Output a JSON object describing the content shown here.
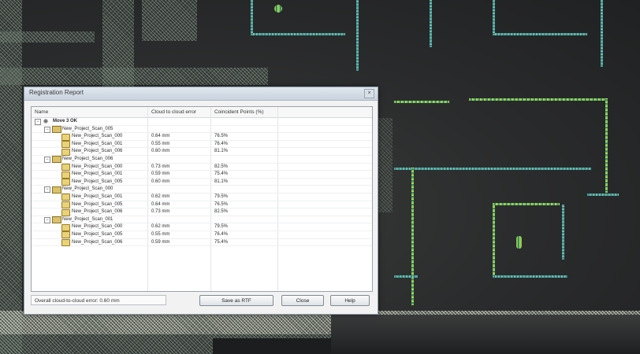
{
  "dialog": {
    "title": "Registration Report",
    "close_glyph": "×",
    "columns": [
      "Name",
      "Cloud to cloud error",
      "Coincident Points (%)"
    ],
    "tree": [
      {
        "level": 0,
        "kind": "root",
        "expander": "−",
        "name": "Move 3 OK",
        "error": "",
        "percent": ""
      },
      {
        "level": 1,
        "kind": "group",
        "expander": "−",
        "name": "New_Project_Scan_005",
        "error": "",
        "percent": ""
      },
      {
        "level": 2,
        "kind": "scan",
        "expander": "",
        "name": "New_Project_Scan_000",
        "error": "0.64 mm",
        "percent": "76.5%"
      },
      {
        "level": 2,
        "kind": "scan",
        "expander": "",
        "name": "New_Project_Scan_001",
        "error": "0.55 mm",
        "percent": "76.4%"
      },
      {
        "level": 2,
        "kind": "scan",
        "expander": "",
        "name": "New_Project_Scan_006",
        "error": "0.60 mm",
        "percent": "81.1%"
      },
      {
        "level": 1,
        "kind": "group",
        "expander": "−",
        "name": "New_Project_Scan_006",
        "error": "",
        "percent": ""
      },
      {
        "level": 2,
        "kind": "scan",
        "expander": "",
        "name": "New_Project_Scan_000",
        "error": "0.73 mm",
        "percent": "82.5%"
      },
      {
        "level": 2,
        "kind": "scan",
        "expander": "",
        "name": "New_Project_Scan_001",
        "error": "0.59 mm",
        "percent": "75.4%"
      },
      {
        "level": 2,
        "kind": "scan",
        "expander": "",
        "name": "New_Project_Scan_005",
        "error": "0.60 mm",
        "percent": "81.1%"
      },
      {
        "level": 1,
        "kind": "group",
        "expander": "−",
        "name": "New_Project_Scan_000",
        "error": "",
        "percent": ""
      },
      {
        "level": 2,
        "kind": "scan",
        "expander": "",
        "name": "New_Project_Scan_001",
        "error": "0.62 mm",
        "percent": "79.5%"
      },
      {
        "level": 2,
        "kind": "scan",
        "expander": "",
        "name": "New_Project_Scan_005",
        "error": "0.64 mm",
        "percent": "76.5%"
      },
      {
        "level": 2,
        "kind": "scan",
        "expander": "",
        "name": "New_Project_Scan_006",
        "error": "0.73 mm",
        "percent": "82.5%"
      },
      {
        "level": 1,
        "kind": "group",
        "expander": "−",
        "name": "New_Project_Scan_001",
        "error": "",
        "percent": ""
      },
      {
        "level": 2,
        "kind": "scan",
        "expander": "",
        "name": "New_Project_Scan_000",
        "error": "0.62 mm",
        "percent": "79.5%"
      },
      {
        "level": 2,
        "kind": "scan",
        "expander": "",
        "name": "New_Project_Scan_005",
        "error": "0.55 mm",
        "percent": "76.4%"
      },
      {
        "level": 2,
        "kind": "scan",
        "expander": "",
        "name": "New_Project_Scan_006",
        "error": "0.59 mm",
        "percent": "75.4%"
      }
    ],
    "overall_error": "Overall cloud-to-cloud error: 0.60 mm",
    "buttons": {
      "save": "Save as RTF",
      "close": "Close",
      "help": "Help"
    }
  }
}
